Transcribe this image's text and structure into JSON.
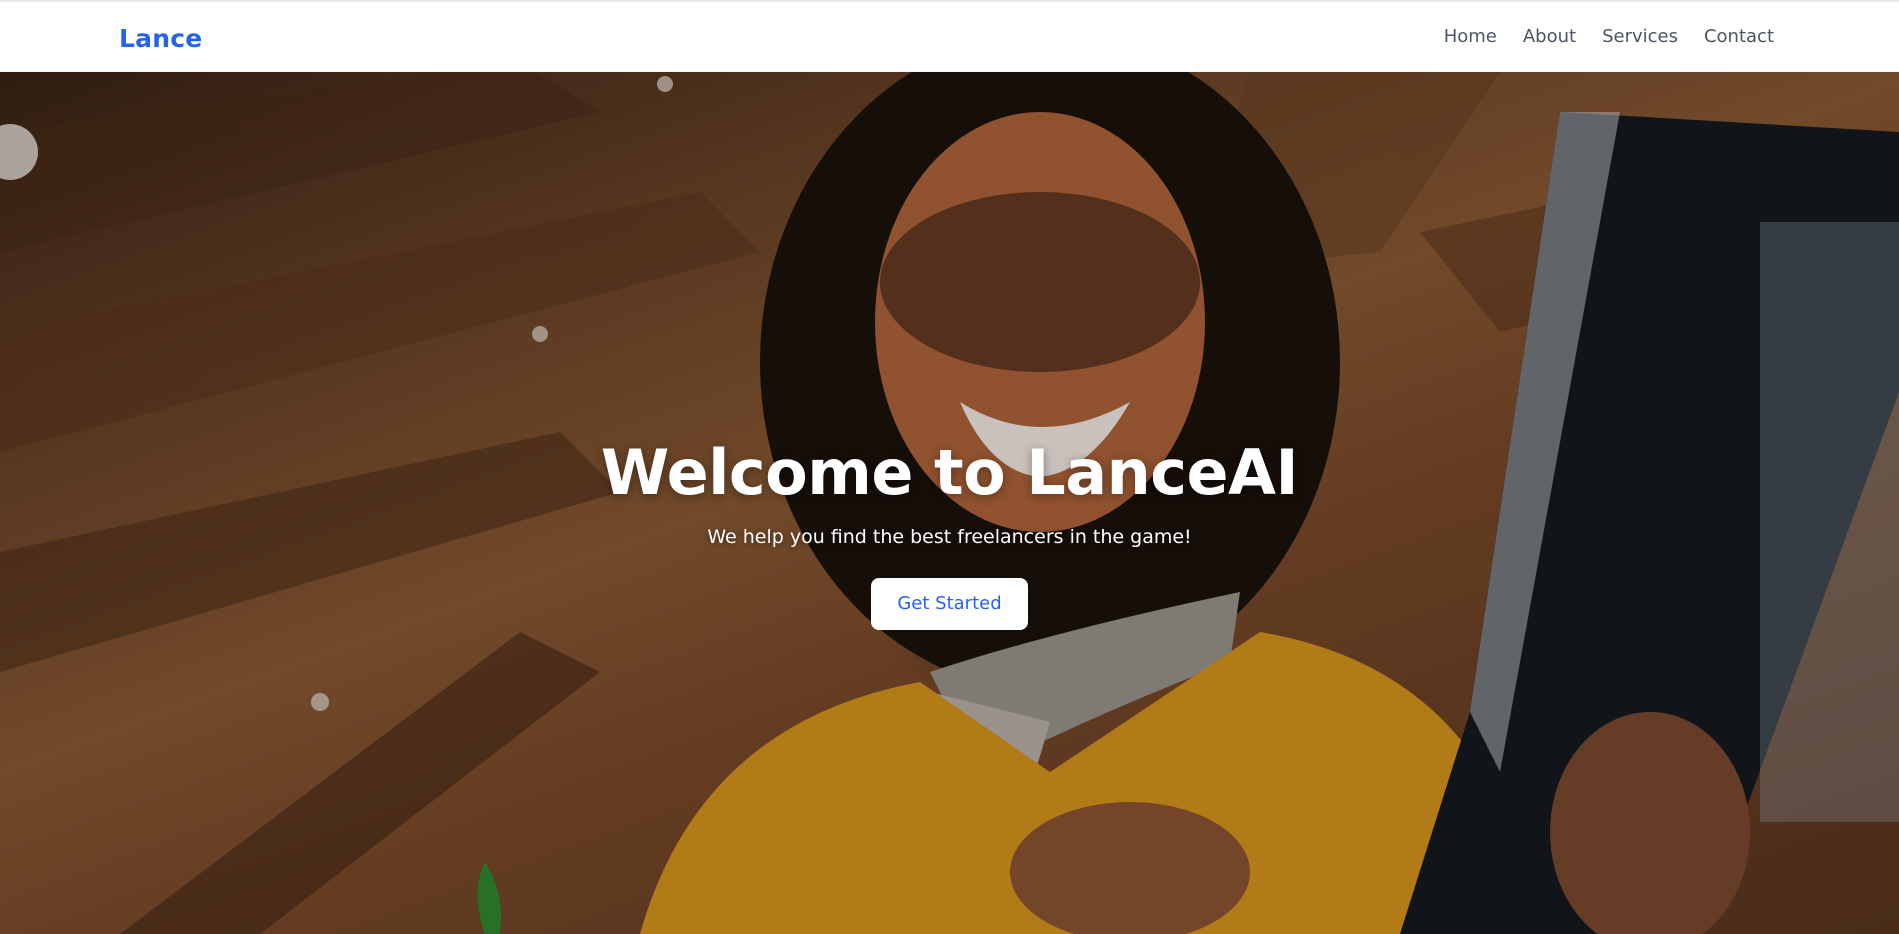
{
  "navbar": {
    "brand": "Lance",
    "links": [
      "Home",
      "About",
      "Services",
      "Contact"
    ]
  },
  "hero": {
    "title": "Welcome to LanceAI",
    "subtitle": "We help you find the best freelancers in the game!",
    "cta_label": "Get Started"
  },
  "colors": {
    "accent": "#2563eb",
    "nav_text": "#4b5563",
    "hero_text": "#ffffff"
  }
}
